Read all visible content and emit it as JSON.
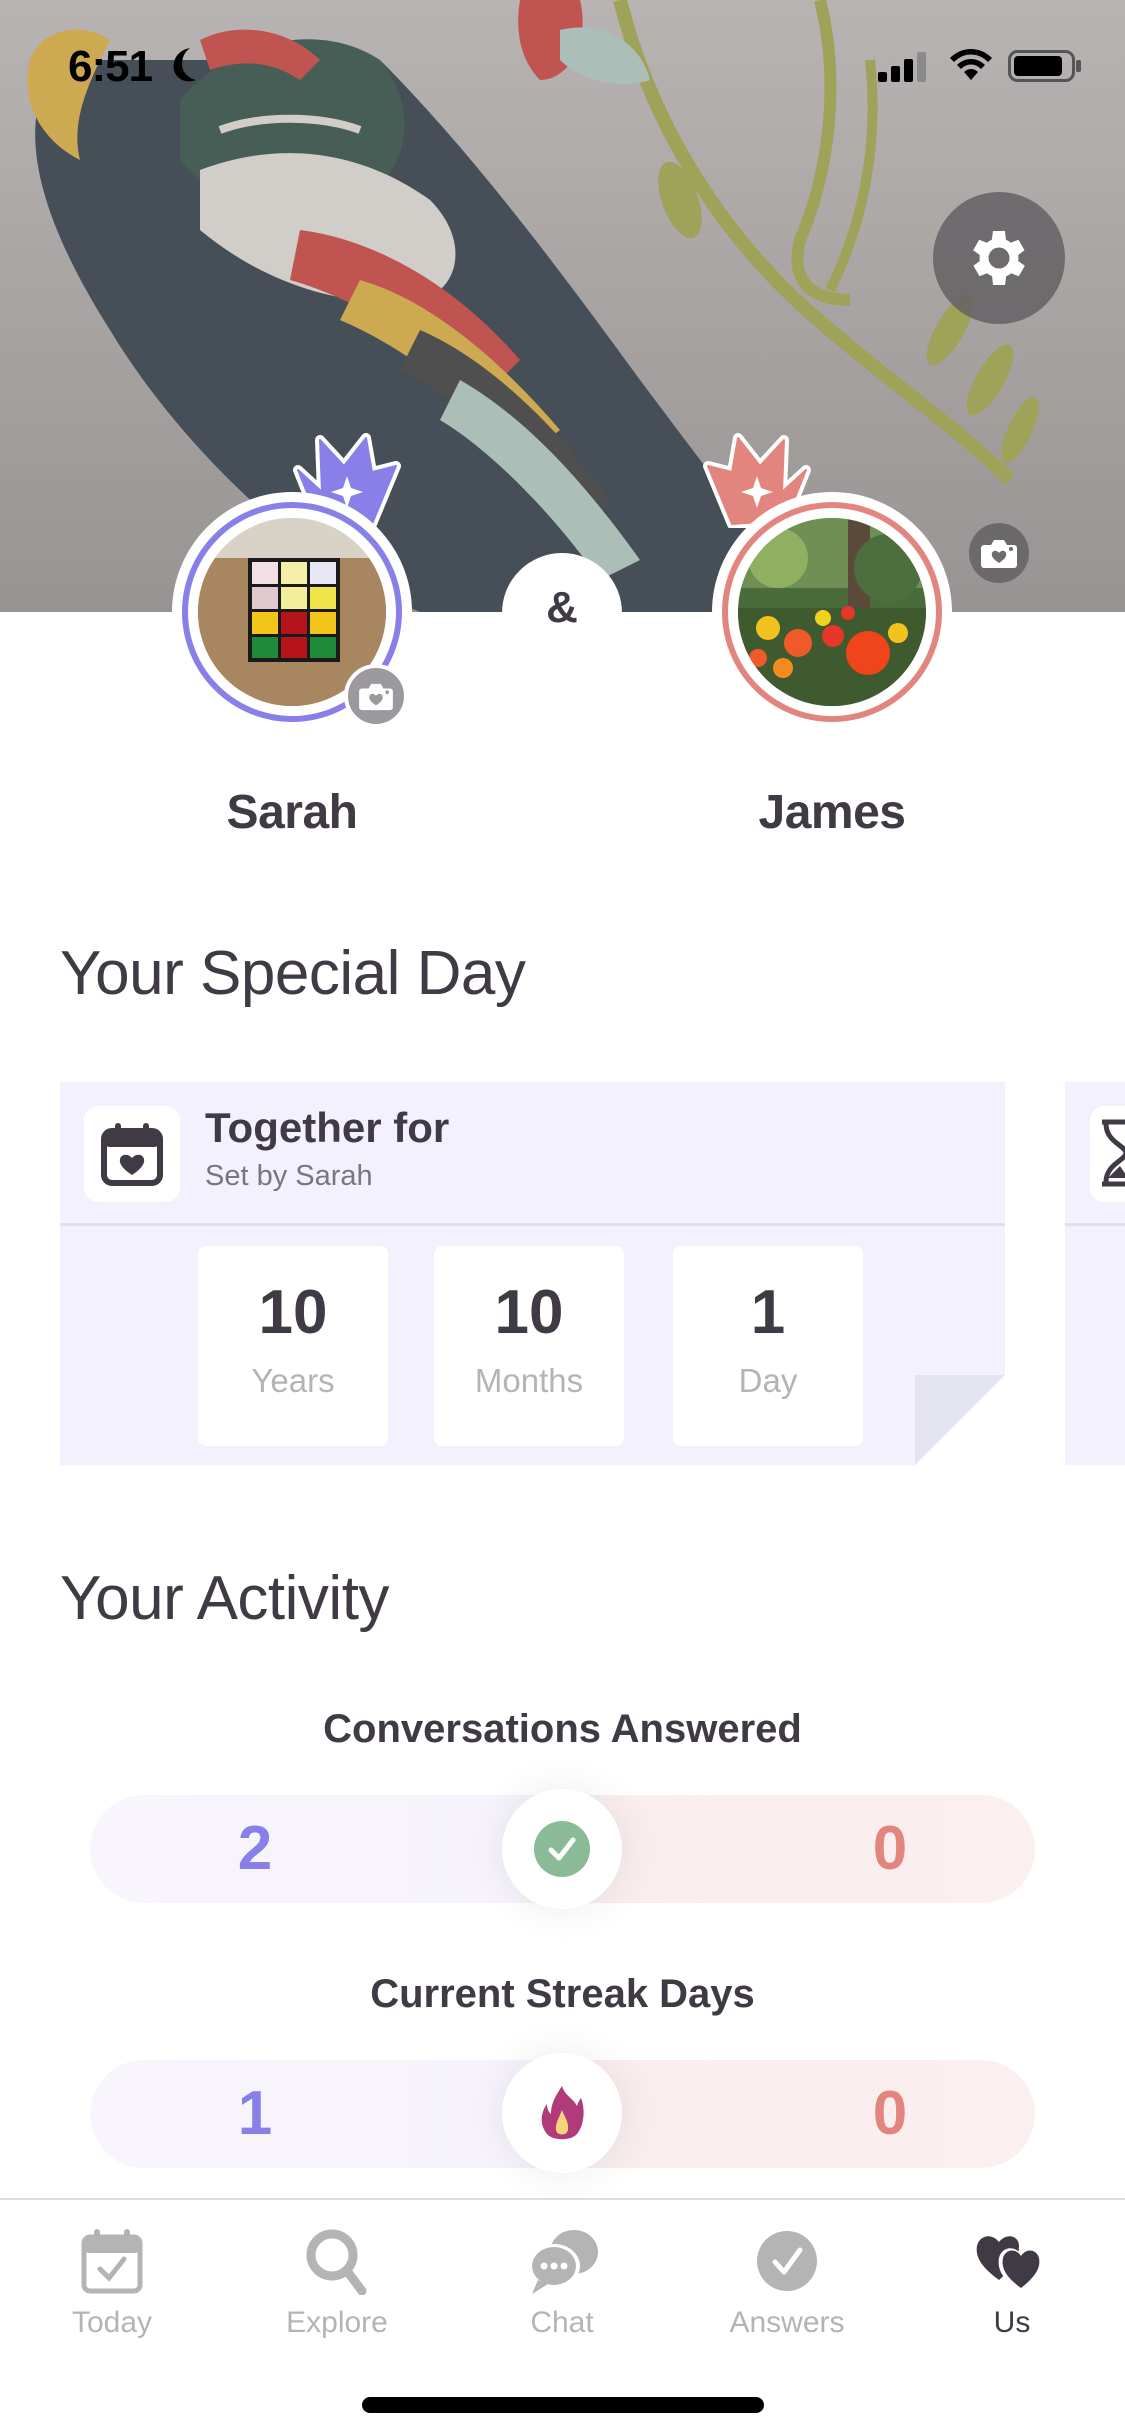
{
  "status_bar": {
    "time": "6:51",
    "focus_icon": "moon-icon",
    "signal_icon": "cellular-signal-icon",
    "wifi_icon": "wifi-icon",
    "battery_icon": "battery-icon"
  },
  "header": {
    "settings_icon": "gear-icon",
    "cover_photo_button_icon": "camera-heart-icon",
    "connector": "&"
  },
  "partners": [
    {
      "name": "Sarah",
      "ring_color": "#8880e8",
      "crown_icon": "crown-icon",
      "photo": "rubiks-cube",
      "camera_icon": "camera-heart-icon"
    },
    {
      "name": "James",
      "ring_color": "#e2857f",
      "crown_icon": "crown-icon",
      "photo": "flower-garden"
    }
  ],
  "special_day": {
    "section_title": "Your Special Day",
    "cards": [
      {
        "icon": "calendar-heart-icon",
        "title": "Together for",
        "subtitle": "Set by Sarah",
        "counts": [
          {
            "value": "10",
            "unit": "Years"
          },
          {
            "value": "10",
            "unit": "Months"
          },
          {
            "value": "1",
            "unit": "Day"
          }
        ]
      },
      {
        "icon": "hourglass-icon"
      }
    ]
  },
  "activity": {
    "section_title": "Your Activity",
    "stats": [
      {
        "label": "Conversations Answered",
        "left_value": "2",
        "right_value": "0",
        "icon": "check-circle-icon"
      },
      {
        "label": "Current Streak Days",
        "left_value": "1",
        "right_value": "0",
        "icon": "flame-icon"
      }
    ]
  },
  "colors": {
    "partner_one": "#8880e8",
    "partner_two": "#e2857f",
    "text_primary": "#403a44",
    "card_bg": "#f2f1fd",
    "check_green": "#8abb96",
    "flame_magenta": "#b03a7a"
  },
  "tabbar": {
    "items": [
      {
        "label": "Today",
        "icon": "calendar-check-icon",
        "active": false
      },
      {
        "label": "Explore",
        "icon": "search-icon",
        "active": false
      },
      {
        "label": "Chat",
        "icon": "chat-bubbles-icon",
        "active": false
      },
      {
        "label": "Answers",
        "icon": "check-circle-icon",
        "active": false
      },
      {
        "label": "Us",
        "icon": "two-hearts-icon",
        "active": true
      }
    ]
  }
}
